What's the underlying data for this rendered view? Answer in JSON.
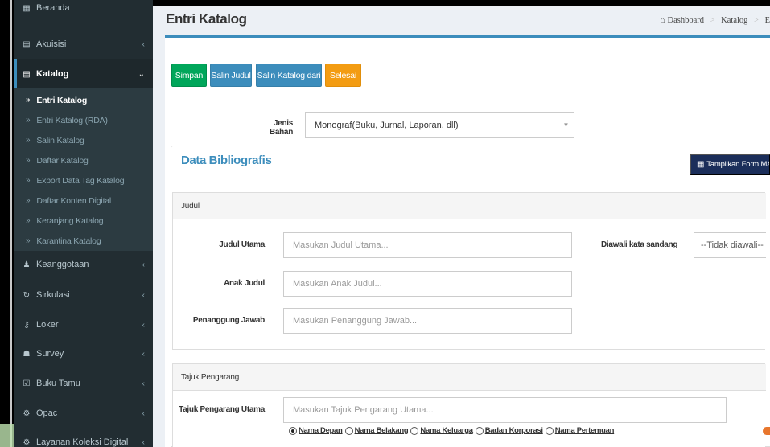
{
  "sidebar": {
    "items": [
      {
        "icon": "dashboard-icon",
        "glyph": "▦",
        "label": "Beranda",
        "has_chevron": false
      },
      {
        "icon": "book-icon",
        "glyph": "▤",
        "label": "Akuisisi",
        "has_chevron": true
      },
      {
        "icon": "book-icon",
        "glyph": "▤",
        "label": "Katalog",
        "has_chevron": true,
        "active": true
      },
      {
        "icon": "user-icon",
        "glyph": "♟",
        "label": "Keanggotaan",
        "has_chevron": true
      },
      {
        "icon": "refresh-icon",
        "glyph": "↻",
        "label": "Sirkulasi",
        "has_chevron": true
      },
      {
        "icon": "key-icon",
        "glyph": "⚷",
        "label": "Loker",
        "has_chevron": true
      },
      {
        "icon": "users-icon",
        "glyph": "☗",
        "label": "Survey",
        "has_chevron": true
      },
      {
        "icon": "check-square-icon",
        "glyph": "☑",
        "label": "Buku Tamu",
        "has_chevron": true
      },
      {
        "icon": "cogs-icon",
        "glyph": "⚙",
        "label": "Opac",
        "has_chevron": true
      },
      {
        "icon": "cogs-icon",
        "glyph": "⚙",
        "label": "Layanan Koleksi Digital",
        "has_chevron": true
      }
    ],
    "chevron_right": "‹",
    "chevron_down": "⌄",
    "submenu": [
      {
        "label": "Entri Katalog",
        "active": true
      },
      {
        "label": "Entri Katalog (RDA)"
      },
      {
        "label": "Salin Katalog"
      },
      {
        "label": "Daftar Katalog"
      },
      {
        "label": "Export Data Tag Katalog"
      },
      {
        "label": "Daftar Konten Digital"
      },
      {
        "label": "Keranjang Katalog"
      },
      {
        "label": "Karantina Katalog"
      }
    ],
    "submenu_arrow": "»"
  },
  "header": {
    "title": "Entri Katalog",
    "breadcrumb": {
      "home_icon": "⌂",
      "items": [
        "Dashboard",
        "Katalog",
        "E"
      ],
      "separator": ">"
    }
  },
  "toolbar": {
    "simpan": "Simpan",
    "salin_judul": "Salin Judul",
    "salin_katalog_dari": "Salin Katalog dari",
    "selesai": "Selesai"
  },
  "jenis_bahan": {
    "label": "Jenis Bahan",
    "value": "Monograf(Buku, Jurnal, Laporan, dll)",
    "caret": "▼"
  },
  "bibliografis": {
    "title": "Data Bibliografis",
    "marc_button": "Tampilkan Form MARC",
    "marc_icon_glyph": "▦"
  },
  "judul": {
    "heading": "Judul",
    "judul_utama_label": "Judul Utama",
    "judul_utama_placeholder": "Masukan Judul Utama...",
    "diawali_label": "Diawali kata sandang",
    "diawali_value": "--Tidak diawali--",
    "anak_judul_label": "Anak Judul",
    "anak_judul_placeholder": "Masukan Anak Judul...",
    "penanggung_label": "Penanggung Jawab",
    "penanggung_placeholder": "Masukan Penanggung Jawab..."
  },
  "pengarang": {
    "heading": "Tajuk Pengarang",
    "utama_label": "Tajuk Pengarang Utama",
    "utama_placeholder": "Masukan Tajuk Pengarang Utama...",
    "options": [
      {
        "label": "Nama Depan",
        "checked": true
      },
      {
        "label": "Nama Belakang",
        "checked": false
      },
      {
        "label": "Nama Keluarga",
        "checked": false
      },
      {
        "label": "Badan Korporasi",
        "checked": false
      },
      {
        "label": "Nama Pertemuan",
        "checked": false
      }
    ]
  }
}
